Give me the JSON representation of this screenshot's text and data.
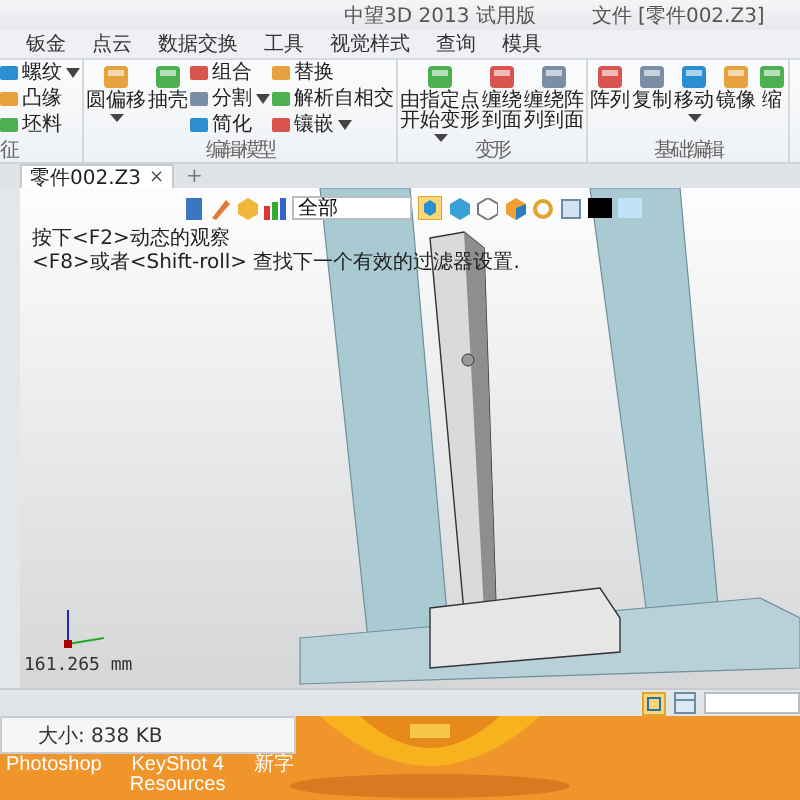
{
  "window": {
    "title": "中望3D 2013 试用版",
    "file": "文件 [零件002.Z3]"
  },
  "menu": [
    {
      "label": "钣金"
    },
    {
      "label": "点云"
    },
    {
      "label": "数据交换"
    },
    {
      "label": "工具"
    },
    {
      "label": "视觉样式"
    },
    {
      "label": "查询"
    },
    {
      "label": "模具"
    }
  ],
  "ribbon": {
    "groups": [
      {
        "label": "征",
        "items": [
          {
            "kind": "small",
            "label": "螺纹",
            "dropdown": true
          },
          {
            "kind": "small",
            "label": "凸缘",
            "dropdown": false
          },
          {
            "kind": "small",
            "label": "坯料",
            "dropdown": false
          }
        ]
      },
      {
        "label": "编辑模型",
        "items": [
          {
            "kind": "large",
            "label": "圆偏移",
            "dropdown": true
          },
          {
            "kind": "large",
            "label": "抽壳",
            "dropdown": false
          },
          {
            "kind": "small",
            "label": "组合",
            "dropdown": false
          },
          {
            "kind": "small",
            "label": "分割",
            "dropdown": true
          },
          {
            "kind": "small",
            "label": "简化",
            "dropdown": false
          },
          {
            "kind": "small",
            "label": "替换",
            "dropdown": false
          },
          {
            "kind": "small",
            "label": "解析自相交",
            "dropdown": false
          },
          {
            "kind": "small",
            "label": "镶嵌",
            "dropdown": true
          }
        ]
      },
      {
        "label": "变形",
        "items": [
          {
            "kind": "large",
            "label": "由指定点开始变形",
            "dropdown": true
          },
          {
            "kind": "large",
            "label": "缠绕到面",
            "dropdown": false
          },
          {
            "kind": "large",
            "label": "缠绕阵列到面",
            "dropdown": false
          }
        ]
      },
      {
        "label": "基础编辑",
        "items": [
          {
            "kind": "large",
            "label": "阵列",
            "dropdown": false
          },
          {
            "kind": "large",
            "label": "复制",
            "dropdown": false
          },
          {
            "kind": "large",
            "label": "移动",
            "dropdown": true
          },
          {
            "kind": "large",
            "label": "镜像",
            "dropdown": false
          },
          {
            "kind": "large",
            "label": "缩",
            "dropdown": false
          }
        ]
      }
    ]
  },
  "document_tabs": [
    {
      "label": "零件002.Z3",
      "selected": true,
      "close": "×"
    }
  ],
  "new_tab": "+",
  "viewport": {
    "filter": "全部",
    "hints": [
      "按下<F2>动态的观察",
      "<F8>或者<Shift-roll> 查找下一个有效的过滤器设置."
    ],
    "measure": "161.265 mm"
  },
  "desktop": {
    "file_info": "大小: 838 KB",
    "icons": [
      {
        "label": "Photoshop"
      },
      {
        "label": "KeyShot 4 Resources"
      },
      {
        "label": "新字"
      }
    ]
  }
}
